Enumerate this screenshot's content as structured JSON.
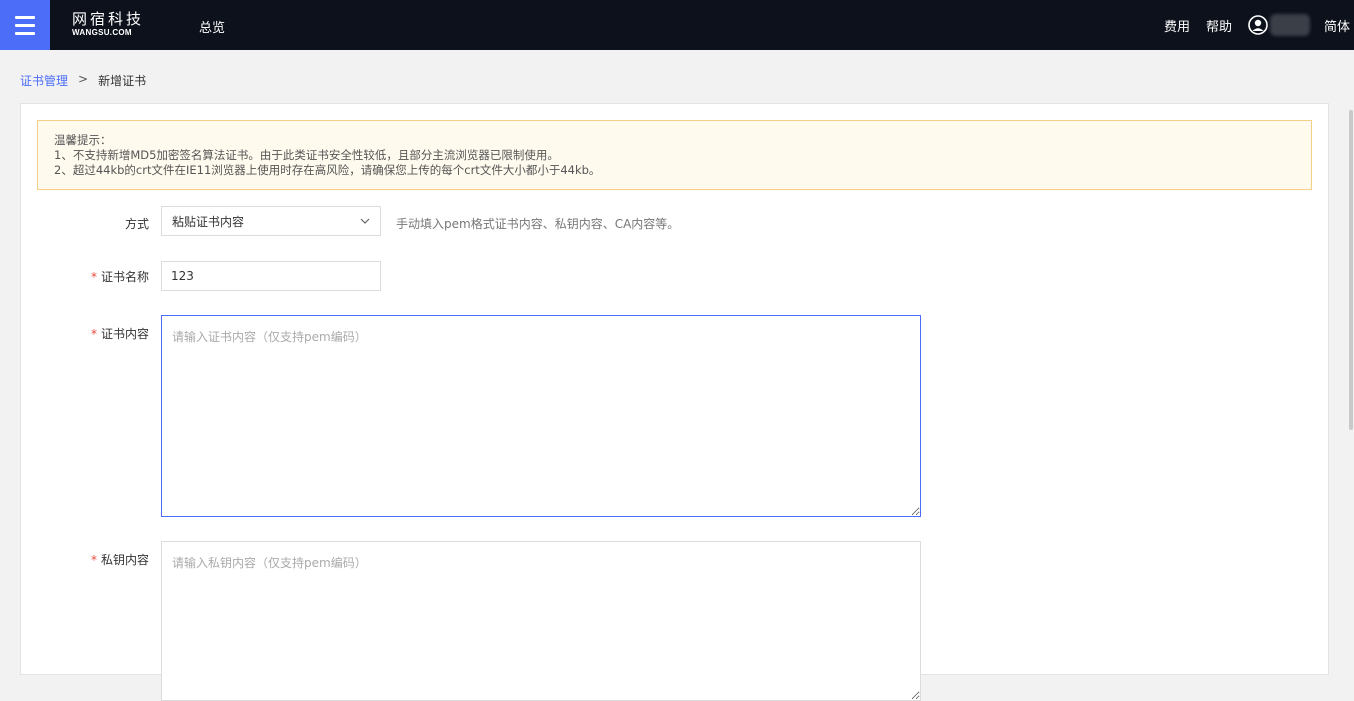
{
  "header": {
    "logo_cn": "网宿科技",
    "logo_en": "WANGSU.COM",
    "nav_overview": "总览",
    "fees": "费用",
    "help": "帮助",
    "language": "简体"
  },
  "breadcrumb": {
    "parent": "证书管理",
    "separator": ">",
    "current": "新增证书"
  },
  "notice": {
    "title": "温馨提示：",
    "line1": "1、不支持新增MD5加密签名算法证书。由于此类证书安全性较低，且部分主流浏览器已限制使用。",
    "line2": "2、超过44kb的crt文件在IE11浏览器上使用时存在高风险，请确保您上传的每个crt文件大小都小于44kb。"
  },
  "form": {
    "method_label": "方式",
    "method_value": "粘贴证书内容",
    "method_hint": "手动填入pem格式证书内容、私钥内容、CA内容等。",
    "name_label": "证书名称",
    "name_value": "123",
    "required_mark": "*",
    "cert_label": "证书内容",
    "cert_placeholder": "请输入证书内容（仅支持pem编码）",
    "key_label": "私钥内容",
    "key_placeholder": "请输入私钥内容（仅支持pem编码）"
  }
}
